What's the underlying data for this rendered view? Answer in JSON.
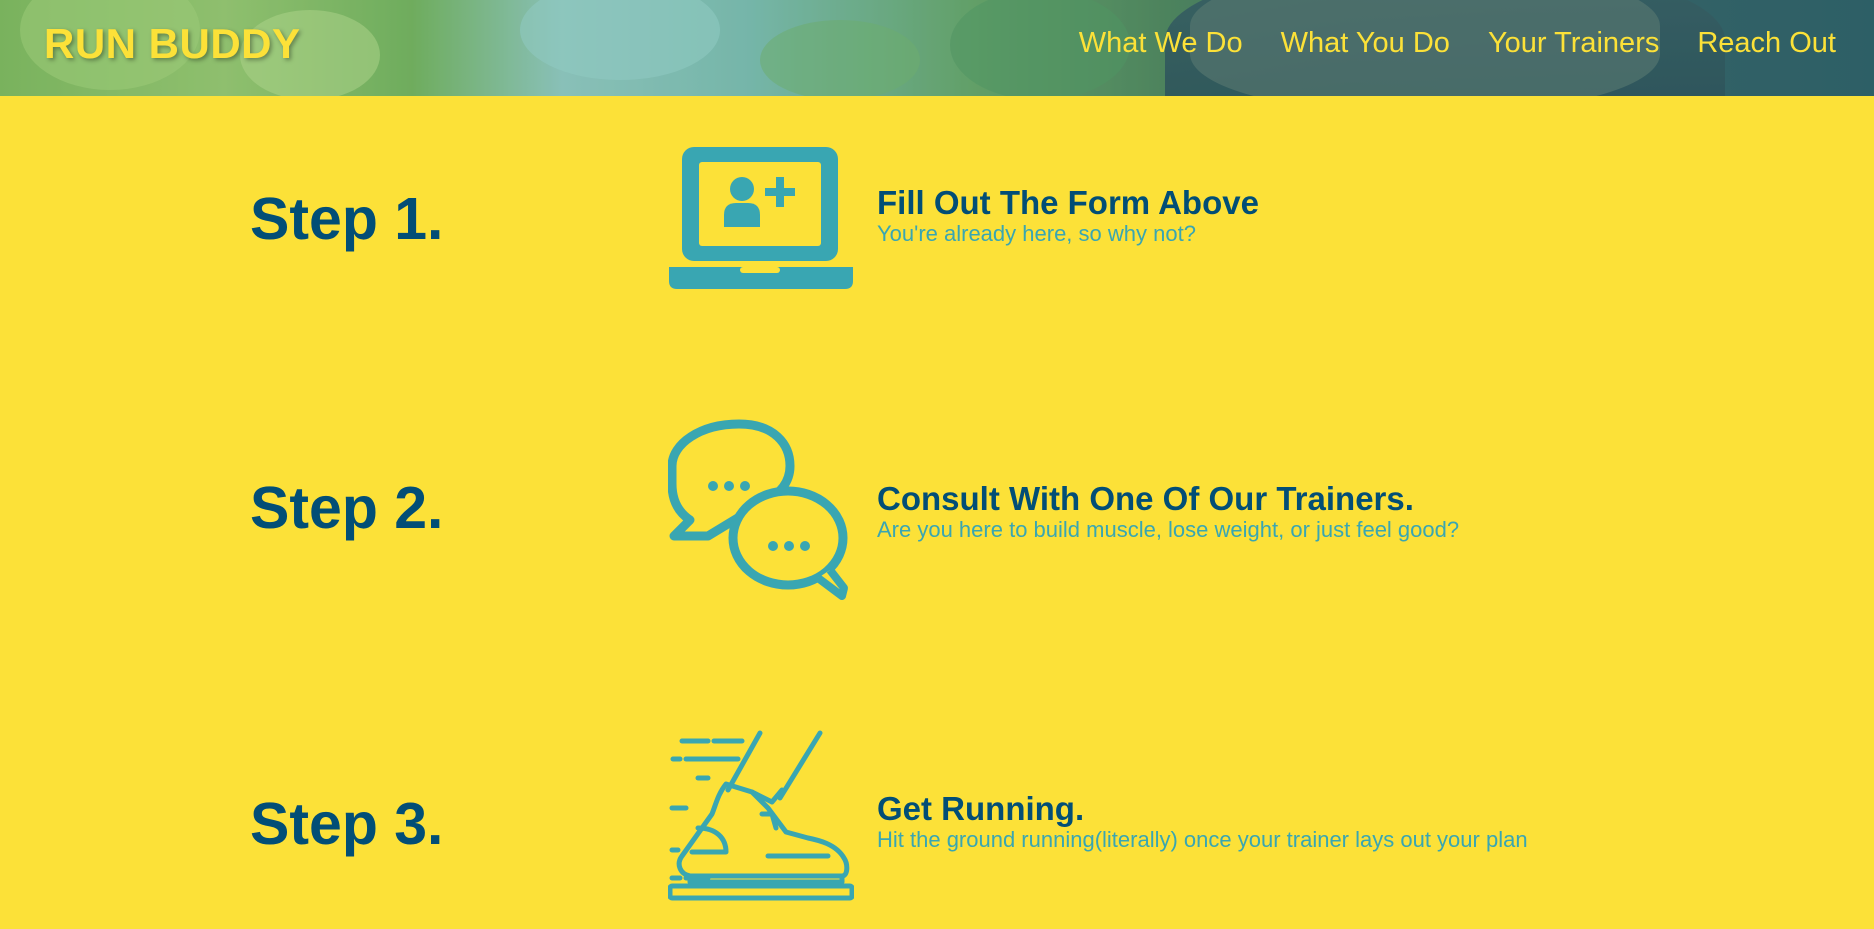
{
  "header": {
    "logo": "RUN BUDDY",
    "nav": [
      "What We Do",
      "What You Do",
      "Your Trainers",
      "Reach Out"
    ]
  },
  "steps": [
    {
      "number": "Step 1.",
      "icon": "laptop-add-user-icon",
      "title": "Fill Out The Form Above",
      "description": "You're already here, so why not?"
    },
    {
      "number": "Step 2.",
      "icon": "chat-bubbles-icon",
      "title": "Consult With One Of Our Trainers.",
      "description": "Are you here to build muscle, lose weight, or just feel good?"
    },
    {
      "number": "Step 3.",
      "icon": "running-shoe-icon",
      "title": "Get Running.",
      "description": "Hit the ground running(literally) once your trainer lays out your plan"
    }
  ],
  "colors": {
    "background": "#fce138",
    "heading": "#024e76",
    "accent": "#39a6b2"
  }
}
